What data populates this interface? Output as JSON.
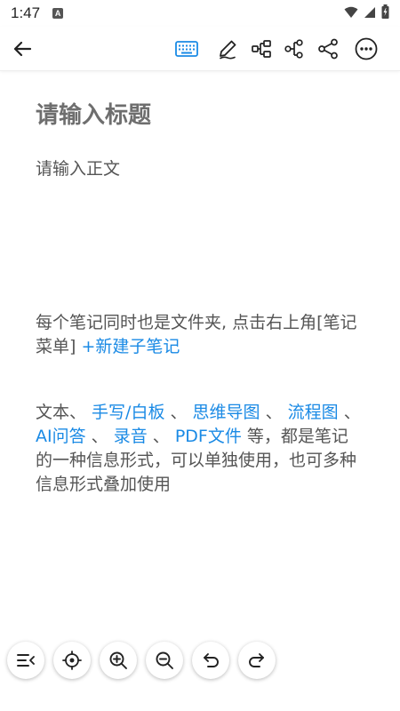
{
  "status_bar": {
    "time": "1:47",
    "notification_badge": "A"
  },
  "toolbar": {
    "icons": [
      "back-arrow-icon",
      "keyboard-icon",
      "pen-icon",
      "mindmap-icon",
      "flowchart-icon",
      "share-icon",
      "more-icon"
    ],
    "accent_color": "#1a8ae5"
  },
  "editor": {
    "title_placeholder": "请输入标题",
    "body_placeholder": "请输入正文"
  },
  "guide": {
    "line1_text": "每个笔记同时也是文件夹, 点击右上角[笔记菜单] ",
    "line1_link": "+新建子笔记",
    "p2_prefix": "文本、 ",
    "link_handwriting": "手写/白板",
    "sep1": " 、 ",
    "link_mindmap": "思维导图",
    "sep2": " 、 ",
    "link_flowchart": "流程图",
    "sep3": " 、 ",
    "link_ai": "AI问答",
    "sep4": " 、 ",
    "link_audio": "录音",
    "sep5": " 、 ",
    "link_pdf": "PDF文件",
    "p2_suffix": " 等，都是笔记的一种信息形式，可以单独使用，也可多种信息形式叠加使用"
  },
  "bottom_bar": {
    "icons": [
      "outline-toggle-icon",
      "locate-icon",
      "zoom-in-icon",
      "zoom-out-icon",
      "undo-icon",
      "redo-icon"
    ]
  }
}
